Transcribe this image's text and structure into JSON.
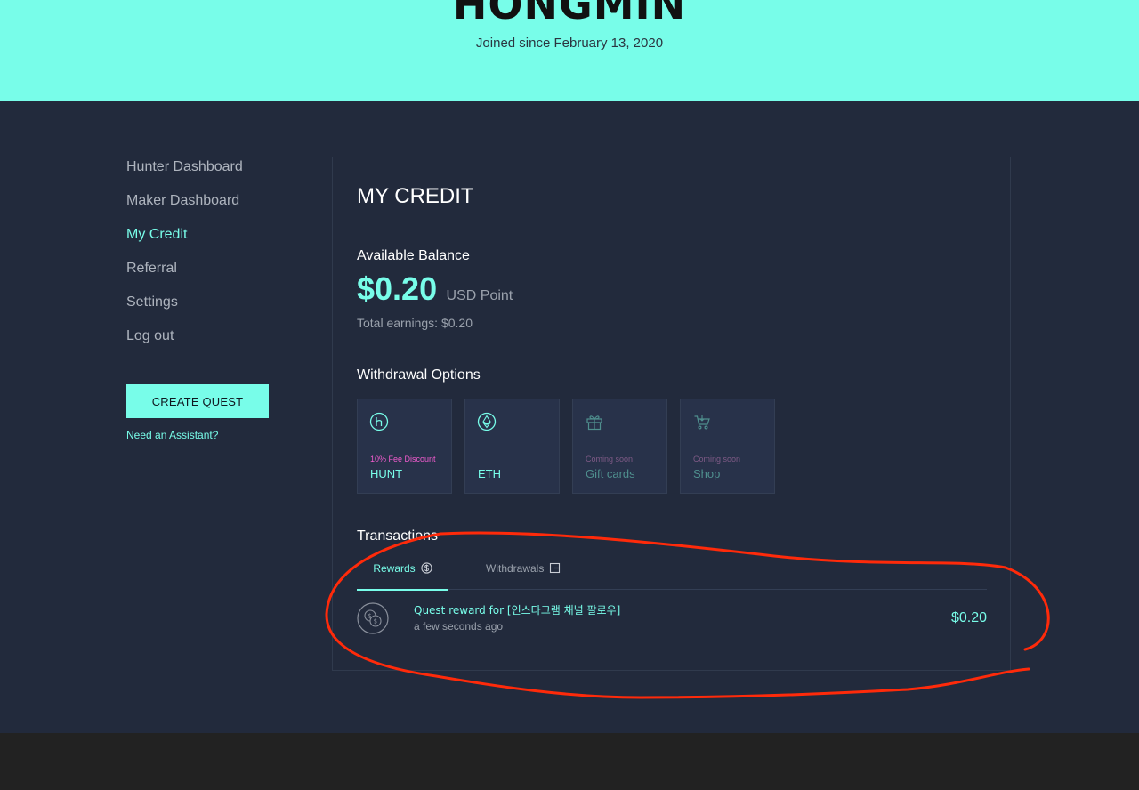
{
  "profile": {
    "name": "HONGMIN",
    "joined": "Joined since February 13, 2020"
  },
  "nav": {
    "items": [
      {
        "label": "Hunter Dashboard"
      },
      {
        "label": "Maker Dashboard"
      },
      {
        "label": "My Credit"
      },
      {
        "label": "Referral"
      },
      {
        "label": "Settings"
      },
      {
        "label": "Log out"
      }
    ],
    "create_quest": "CREATE QUEST",
    "assistant_link": "Need an Assistant?"
  },
  "credit": {
    "title": "MY CREDIT",
    "available_label": "Available Balance",
    "balance": "$0.20",
    "unit": "USD Point",
    "total": "Total earnings: $0.20",
    "withdrawal_label": "Withdrawal Options",
    "options": [
      {
        "icon": "hunt-icon",
        "note": "10% Fee Discount",
        "name": "HUNT"
      },
      {
        "icon": "eth-icon",
        "note": "",
        "name": "ETH"
      },
      {
        "icon": "gift-icon",
        "note": "Coming soon",
        "name": "Gift cards"
      },
      {
        "icon": "cart-icon",
        "note": "Coming soon",
        "name": "Shop"
      }
    ],
    "transactions_label": "Transactions",
    "tabs": {
      "rewards": "Rewards",
      "withdrawals": "Withdrawals"
    },
    "transaction": {
      "icon": "coins-icon",
      "title": "Quest reward for [인스타그램 채널 팔로우]",
      "time": "a few seconds ago",
      "amount": "$0.20"
    }
  },
  "colors": {
    "accent": "#78fde9",
    "background": "#222a3c",
    "annotation": "#ff2a0a",
    "discount": "#f25ccf"
  }
}
